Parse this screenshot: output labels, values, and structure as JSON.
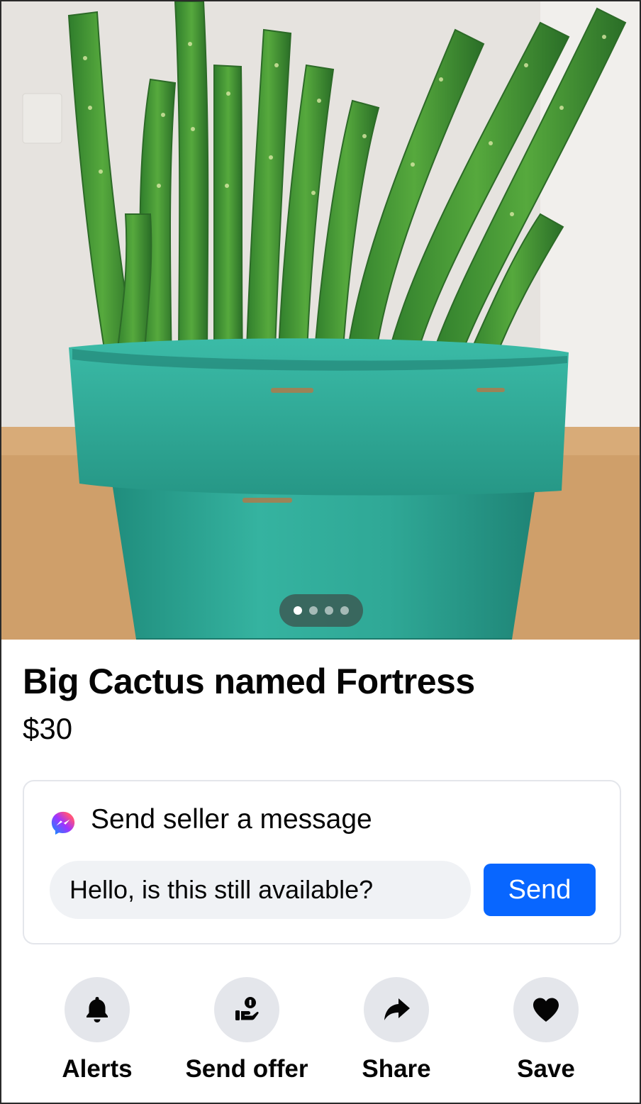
{
  "listing": {
    "title": "Big Cactus named Fortress",
    "price": "$30",
    "photo": {
      "subject": "cactus-in-teal-pot-photo",
      "pager": {
        "count": 4,
        "active_index": 0
      }
    }
  },
  "message_card": {
    "heading": "Send seller a message",
    "icon": "messenger-icon",
    "input_value": "Hello, is this still available?",
    "send_label": "Send",
    "send_color": "#0866ff"
  },
  "actions": [
    {
      "label": "Alerts",
      "icon": "bell-icon"
    },
    {
      "label": "Send offer",
      "icon": "offer-hand-icon"
    },
    {
      "label": "Share",
      "icon": "share-arrow-icon"
    },
    {
      "label": "Save",
      "icon": "heart-icon"
    }
  ]
}
